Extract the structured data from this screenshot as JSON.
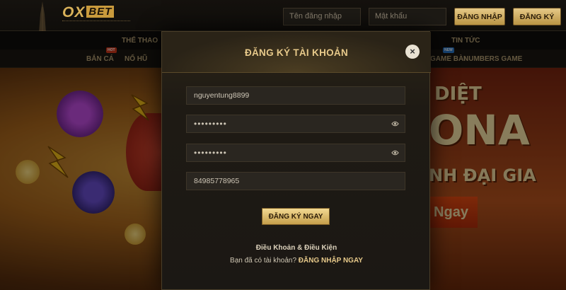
{
  "header": {
    "logo_main": "OX",
    "logo_accent": "BET",
    "username_placeholder": "Tên đăng nhập",
    "password_placeholder": "Mật khẩu",
    "login_button": "ĐĂNG NHẬP",
    "register_button": "ĐĂNG KÝ"
  },
  "nav": {
    "primary": {
      "sports": "THỂ THAO",
      "news": "TIN TỨC"
    },
    "secondary": {
      "fish": "BẮN CÁ",
      "fish_badge": "HOT",
      "slots": "NỔ HŨ",
      "cards": "GAME BÀI",
      "cards_badge": "NEW",
      "numbers": "NUMBERS GAME"
    }
  },
  "banner": {
    "line1": "DIỆT",
    "line2": "ONA",
    "line3": "NH ĐẠI GIA",
    "tag": "Ngay"
  },
  "modal": {
    "title": "ĐĂNG KÝ TÀI KHOẢN",
    "close": "×",
    "username_value": "nguyentung8899",
    "password_value": "•••••••••",
    "confirm_password_value": "•••••••••",
    "phone_value": "84985778965",
    "submit_label": "ĐĂNG KÝ NGAY",
    "terms_label": "Điều Khoản & Điều Kiện",
    "have_account_text": "Bạn đã có tài khoản?",
    "login_now_link": "ĐĂNG NHẬP NGAY"
  },
  "colors": {
    "accent_gold": "#e7c98a",
    "button_gold": "#c59e4b",
    "modal_bg": "#1e1a14"
  }
}
